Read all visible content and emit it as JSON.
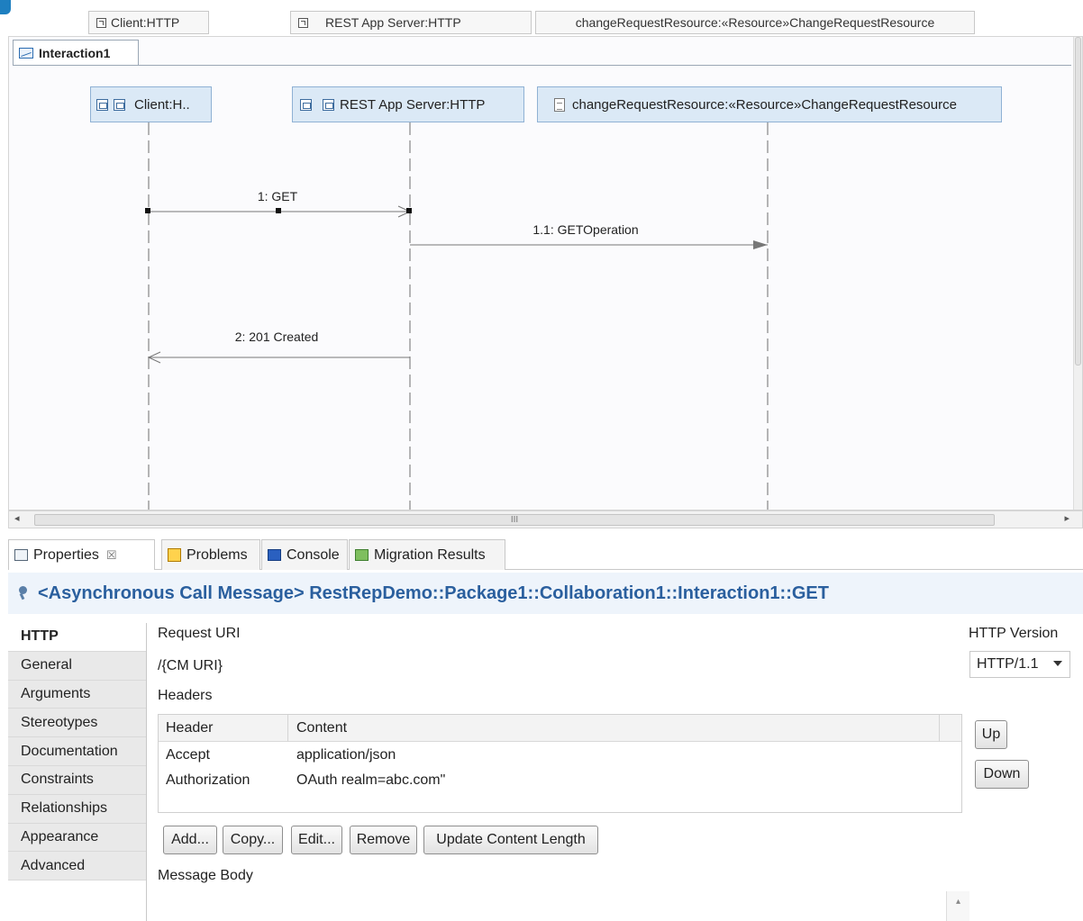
{
  "top_strip": {
    "cells": [
      "Client:HTTP",
      "REST App Server:HTTP",
      "changeRequestResource:«Resource»ChangeRequestResource"
    ]
  },
  "diagram": {
    "frame_title": "Interaction1",
    "lifelines": [
      {
        "label": "Client:H.."
      },
      {
        "label": "REST App Server:HTTP"
      },
      {
        "label": "changeRequestResource:«Resource»ChangeRequestResource"
      }
    ],
    "messages": [
      {
        "label": "1: GET"
      },
      {
        "label": "1.1: GETOperation"
      },
      {
        "label": "2: 201 Created"
      }
    ],
    "scroll_glyph": "III"
  },
  "view_tabs": [
    {
      "label": "Properties",
      "close": "☒"
    },
    {
      "label": "Problems"
    },
    {
      "label": "Console"
    },
    {
      "label": "Migration Results"
    }
  ],
  "properties": {
    "header": "<Asynchronous Call Message> RestRepDemo::Package1::Collaboration1::Interaction1::GET",
    "tabs": [
      "HTTP",
      "General",
      "Arguments",
      "Stereotypes",
      "Documentation",
      "Constraints",
      "Relationships",
      "Appearance",
      "Advanced"
    ],
    "active_tab": "HTTP",
    "http": {
      "request_uri_label": "Request URI",
      "request_uri_value": "/{CM URI}",
      "version_label": "HTTP Version",
      "version_value": "HTTP/1.1",
      "headers_label": "Headers",
      "columns": [
        "Header",
        "Content"
      ],
      "rows": [
        {
          "header": "Accept",
          "content": "application/json"
        },
        {
          "header": "Authorization",
          "content": "OAuth realm=abc.com\""
        }
      ],
      "side_buttons": [
        "Up",
        "Down"
      ],
      "buttons": [
        "Add...",
        "Copy...",
        "Edit...",
        "Remove",
        "Update Content Length"
      ],
      "message_body_label": "Message Body"
    }
  }
}
